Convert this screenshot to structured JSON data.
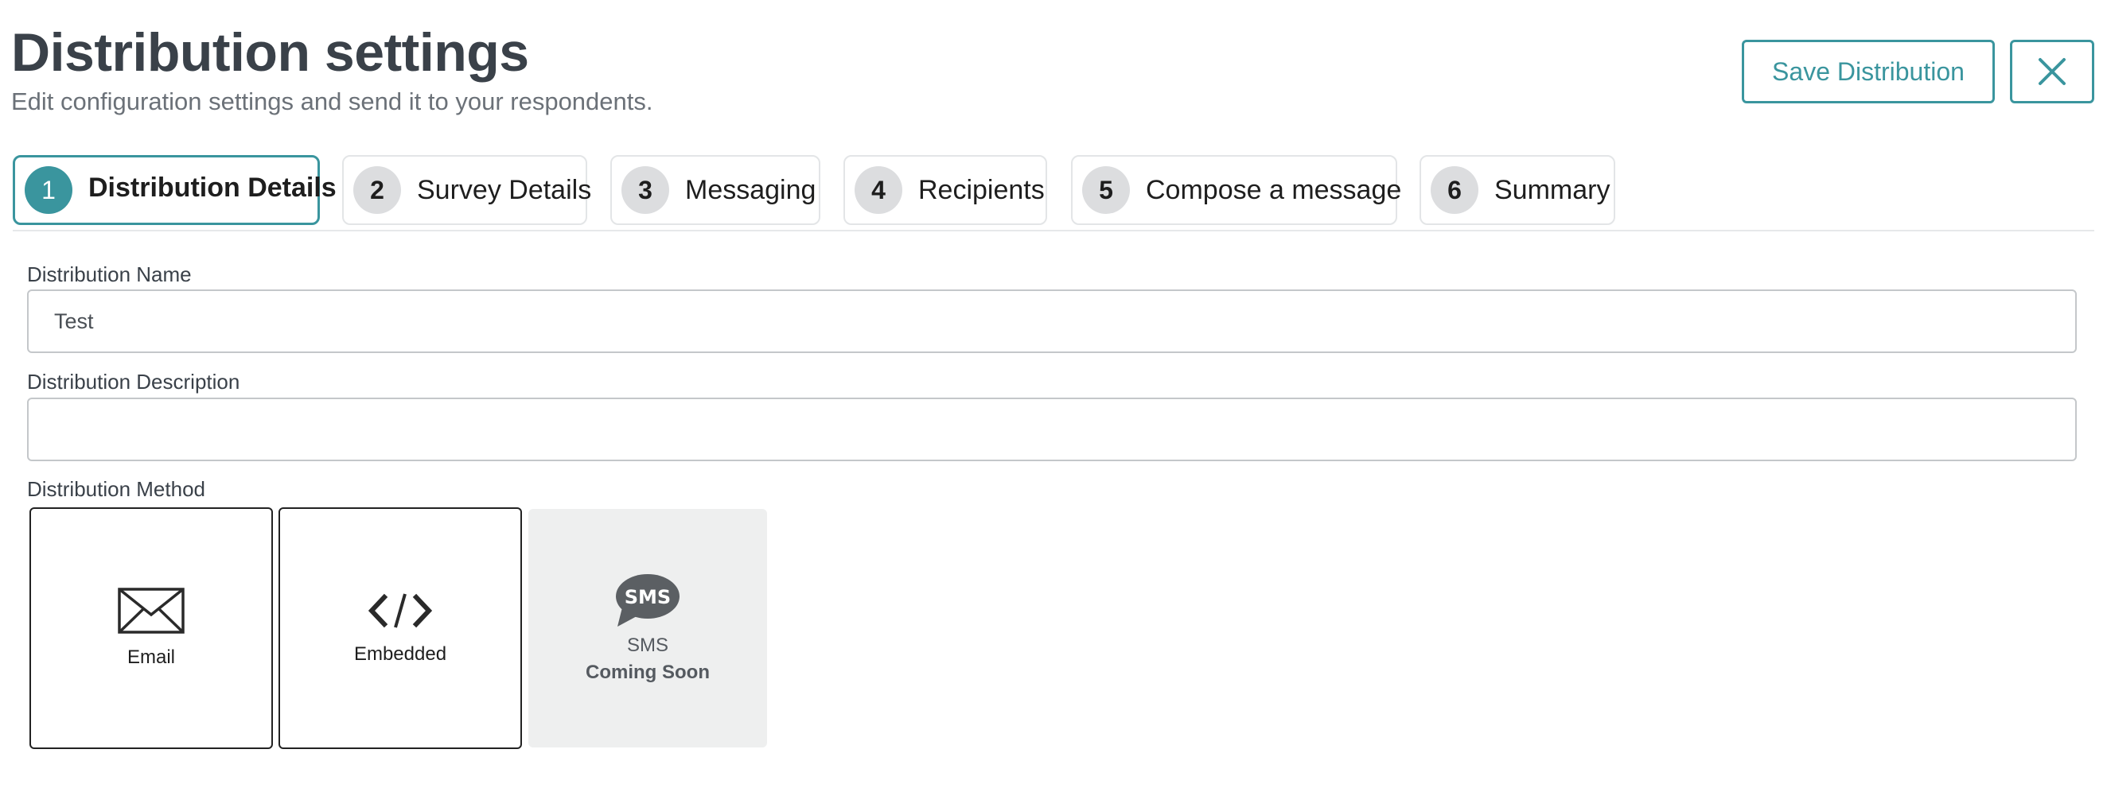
{
  "header": {
    "title": "Distribution settings",
    "subtitle": "Edit configuration settings and send it to your respondents.",
    "save_label": "Save Distribution",
    "close_icon": "close-icon"
  },
  "steps": [
    {
      "num": "1",
      "label": "Distribution Details",
      "active": true
    },
    {
      "num": "2",
      "label": "Survey Details",
      "active": false
    },
    {
      "num": "3",
      "label": "Messaging",
      "active": false
    },
    {
      "num": "4",
      "label": "Recipients",
      "active": false
    },
    {
      "num": "5",
      "label": "Compose a message",
      "active": false
    },
    {
      "num": "6",
      "label": "Summary",
      "active": false
    }
  ],
  "form": {
    "name_label": "Distribution Name",
    "name_value": "Test",
    "description_label": "Distribution Description",
    "description_value": "",
    "method_label": "Distribution Method"
  },
  "methods": [
    {
      "label": "Email",
      "icon": "envelope-icon"
    },
    {
      "label": "Embedded",
      "icon": "code-icon"
    },
    {
      "label": "SMS",
      "sub": "Coming Soon",
      "icon": "sms-bubble-icon",
      "icon_text": "SMS"
    }
  ],
  "colors": {
    "accent": "#3a959e",
    "step_inactive": "#dcdddf",
    "disabled_tile": "#eeefef"
  }
}
